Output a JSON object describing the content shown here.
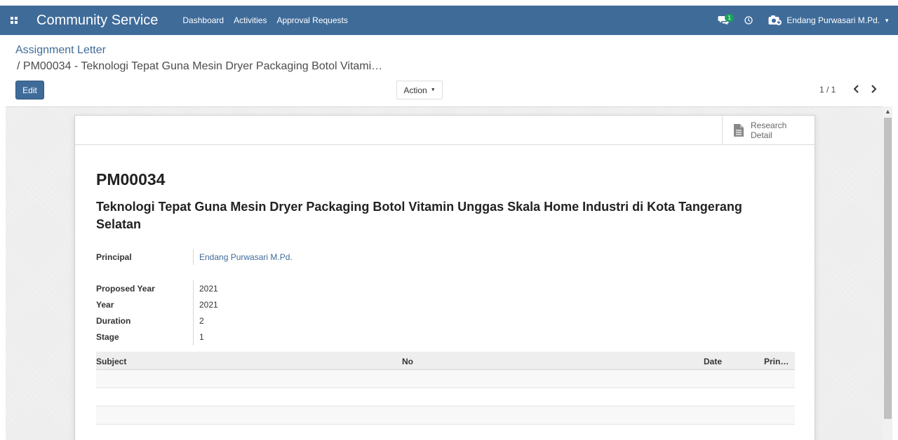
{
  "app": {
    "brand": "Community Service",
    "menu": [
      "Dashboard",
      "Activities",
      "Approval Requests"
    ],
    "chat_count": "1",
    "user_name": "Endang Purwasari M.Pd."
  },
  "breadcrumb": {
    "parent": "Assignment Letter",
    "current": "/ PM00034 - Teknologi Tepat Guna Mesin Dryer Packaging Botol Vitami…"
  },
  "toolbar": {
    "edit_label": "Edit",
    "action_label": "Action",
    "pager": "1 / 1"
  },
  "stat_button": {
    "line1": "Research",
    "line2": "Detail"
  },
  "record": {
    "code": "PM00034",
    "title": "Teknologi Tepat Guna Mesin Dryer Packaging Botol Vitamin Unggas Skala Home Industri di Kota Tangerang Selatan"
  },
  "fields": {
    "principal": {
      "label": "Principal",
      "value": "Endang Purwasari M.Pd."
    },
    "proposed_year": {
      "label": "Proposed Year",
      "value": "2021"
    },
    "year": {
      "label": "Year",
      "value": "2021"
    },
    "duration": {
      "label": "Duration",
      "value": "2"
    },
    "stage": {
      "label": "Stage",
      "value": "1"
    }
  },
  "table": {
    "columns": [
      "Subject",
      "No",
      "Date",
      "Prin…"
    ],
    "rows": []
  },
  "colors": {
    "navbar": "#3f6b99",
    "primary_button": "#3f6b99",
    "badge": "#1aa35b"
  },
  "icons": [
    "apps-grid-icon",
    "chat-icon",
    "clock-icon",
    "camera-icon",
    "chevron-left-icon",
    "chevron-right-icon",
    "document-icon"
  ]
}
